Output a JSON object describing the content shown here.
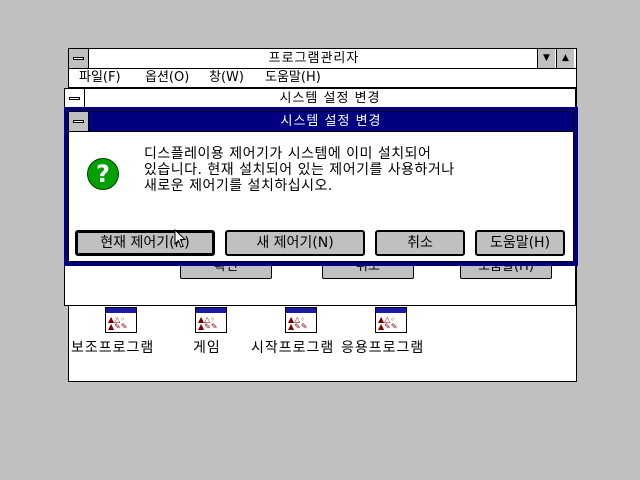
{
  "program_manager": {
    "title": "프로그램관리자",
    "menu": [
      "파일(F)",
      "옵션(O)",
      "창(W)",
      "도움말(H)"
    ],
    "minimize_glyph": "▼",
    "maximize_glyph": "▲",
    "groups": [
      {
        "label": "보조프로그램",
        "icon": "program-group-icon"
      },
      {
        "label": "게임",
        "icon": "program-group-icon"
      },
      {
        "label": "시작프로그램",
        "icon": "program-group-icon"
      },
      {
        "label": "응용프로그램",
        "icon": "program-group-icon"
      }
    ]
  },
  "background_dialog": {
    "title": "시스템 설정 변경",
    "buttons": [
      "확인",
      "취소",
      "도움말(H)"
    ]
  },
  "dialog": {
    "title": "시스템 설정 변경",
    "icon": "question-icon",
    "icon_glyph": "?",
    "message": [
      "디스플레이용 제어기가 시스템에 이미 설치되어",
      "있습니다. 현재 설치되어 있는 제어기를 사용하거나",
      "새로운 제어기를 설치하십시오."
    ],
    "buttons": {
      "current": "현재 제어기(R)",
      "new": "새 제어기(N)",
      "cancel": "취소",
      "help": "도움말(H)"
    }
  },
  "colors": {
    "desktop": "#c0c0c0",
    "active_title": "#000080",
    "icon_green": "#00a000"
  }
}
